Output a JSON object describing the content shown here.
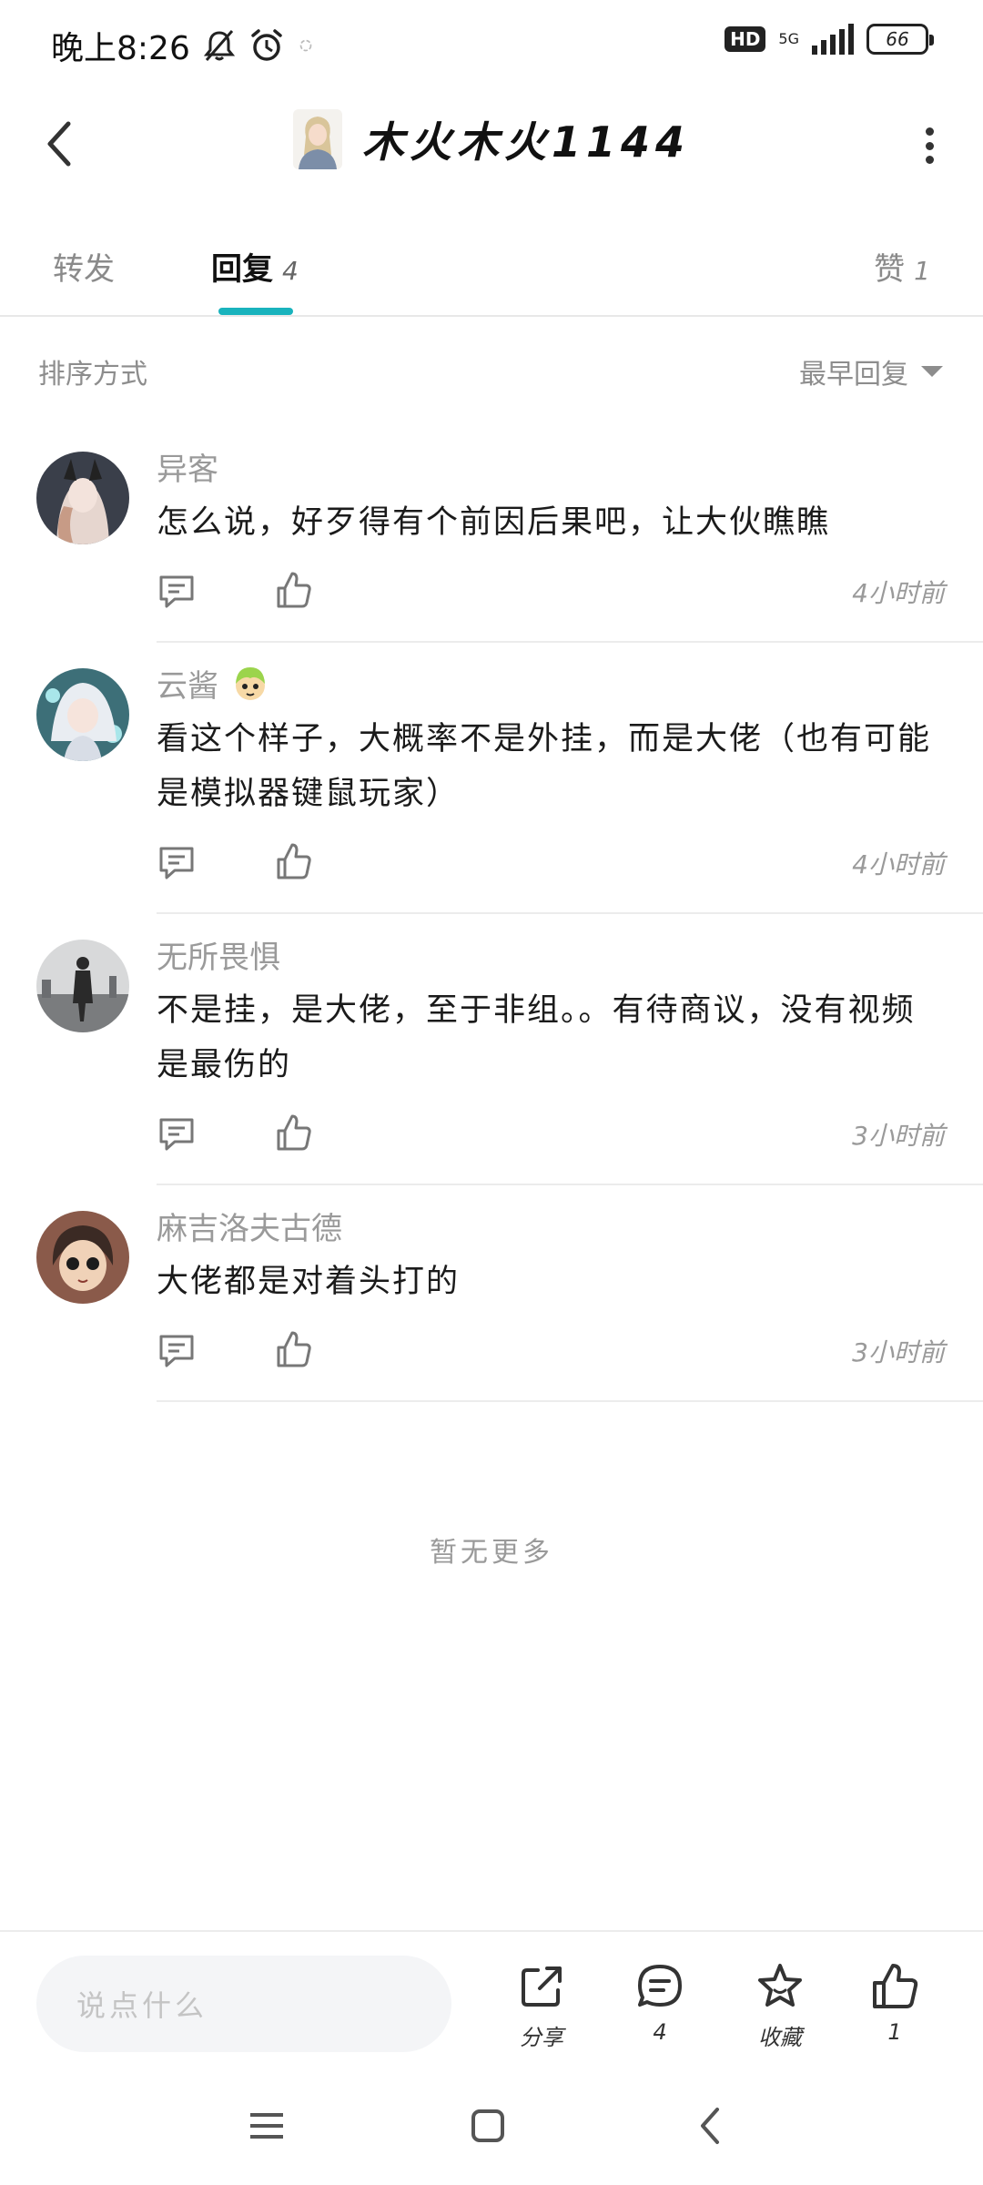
{
  "status_bar": {
    "time": "晚上8:26",
    "hd": "HD",
    "network": "5G",
    "battery": "66"
  },
  "header": {
    "title": "木火木火1144"
  },
  "tabs": [
    {
      "label": "转发",
      "count": ""
    },
    {
      "label": "回复",
      "count": "4"
    },
    {
      "label": "赞",
      "count": "1"
    }
  ],
  "sort": {
    "label": "排序方式",
    "selected": "最早回复"
  },
  "comments": [
    {
      "name": "异客",
      "text": "怎么说，好歹得有个前因后果吧，让大伙瞧瞧",
      "time": "4小时前",
      "has_badge": false
    },
    {
      "name": "云酱",
      "text": "看这个样子，大概率不是外挂，而是大佬（也有可能是模拟器键鼠玩家）",
      "time": "4小时前",
      "has_badge": true
    },
    {
      "name": "无所畏惧",
      "text": "不是挂，是大佬，至于非组。。有待商议，没有视频是最伤的",
      "time": "3小时前",
      "has_badge": false
    },
    {
      "name": "麻吉洛夫古德",
      "text": "大佬都是对着头打的",
      "time": "3小时前",
      "has_badge": false
    }
  ],
  "no_more": "暂无更多",
  "bottom_bar": {
    "input_placeholder": "说点什么",
    "share_label": "分享",
    "comments_count": "4",
    "favorite_label": "收藏",
    "likes_count": "1"
  },
  "colors": {
    "accent": "#19b3bd",
    "muted_text": "#9a9a9a"
  }
}
